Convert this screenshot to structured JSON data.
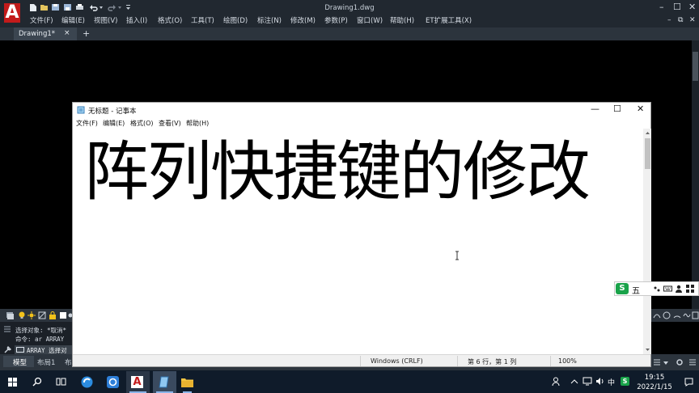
{
  "cad": {
    "app_logo": "A",
    "title": "Drawing1.dwg",
    "menu": [
      "文件(F)",
      "编辑(E)",
      "视图(V)",
      "插入(I)",
      "格式(O)",
      "工具(T)",
      "绘图(D)",
      "标注(N)",
      "修改(M)",
      "参数(P)",
      "窗口(W)",
      "帮助(H)",
      "ET扩展工具(X)"
    ],
    "drawing_tab": "Drawing1*",
    "tab_close": "×",
    "tab_add": "+",
    "command_lines": [
      "选择对象: *取消*",
      "命令: ar ARRAY"
    ],
    "command_input": "ARRAY 选择对",
    "layout_tabs": [
      "模型",
      "布局1",
      "布"
    ],
    "window_controls": {
      "minimize": "–",
      "maximize": "☐",
      "close": "✕"
    },
    "doc_controls": {
      "minimize": "–",
      "restore": "⧉",
      "close": "✕"
    }
  },
  "notepad": {
    "title": "无标题 - 记事本",
    "menu": [
      "文件(F)",
      "编辑(E)",
      "格式(O)",
      "查看(V)",
      "帮助(H)"
    ],
    "content": "阵列快捷键的修改",
    "status": {
      "encoding": "Windows (CRLF)",
      "position": "第 6 行，第 1 列",
      "zoom": "100%"
    },
    "controls": {
      "minimize": "—",
      "maximize": "☐",
      "close": "✕"
    }
  },
  "ime": {
    "logo": "S",
    "mode": "五"
  },
  "taskbar": {
    "time": "19:15",
    "date": "2022/1/15",
    "ime_char": "中"
  },
  "colors": {
    "cad_red": "#c31b1b",
    "cad_dark": "#212830",
    "taskbar": "#0f1b2a",
    "sogou_green": "#1aa34a"
  }
}
